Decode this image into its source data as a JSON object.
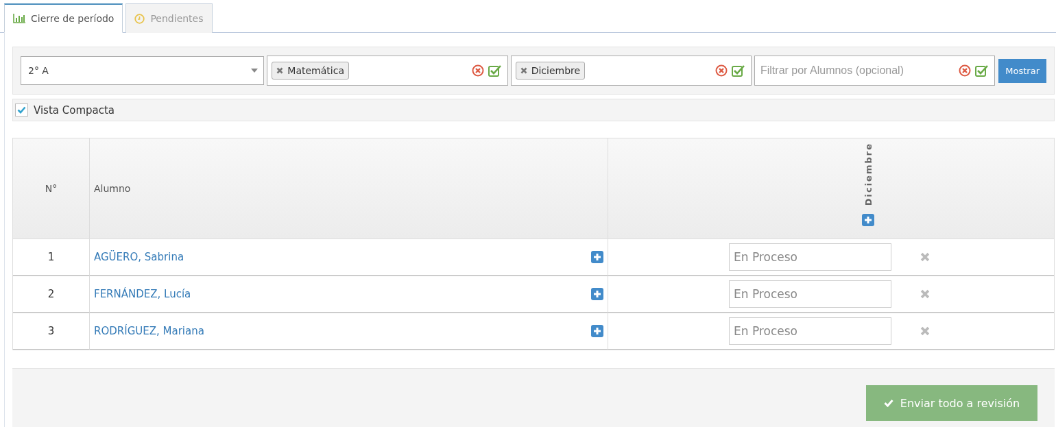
{
  "tabs": [
    {
      "label": "Cierre de período",
      "selected": true
    },
    {
      "label": "Pendientes",
      "selected": false
    }
  ],
  "filters": {
    "course_select": {
      "value": "2° A"
    },
    "tag_fields": [
      {
        "tags": [
          "Matemática"
        ]
      },
      {
        "tags": [
          "Diciembre"
        ]
      },
      {
        "placeholder": "Filtrar por Alumnos (opcional)"
      }
    ],
    "show_button": "Mostrar"
  },
  "compact_view": {
    "label": "Vista Compacta",
    "checked": true
  },
  "table": {
    "columns": [
      "N°",
      "Alumno",
      "Diciembre"
    ],
    "rows": [
      {
        "number": "1",
        "student": "AGÜERO, Sabrina",
        "placeholder": "En Proceso"
      },
      {
        "number": "2",
        "student": "FERNÁNDEZ, Lucía",
        "placeholder": "En Proceso"
      },
      {
        "number": "3",
        "student": "RODRÍGUEZ, Mariana",
        "placeholder": "En Proceso"
      }
    ]
  },
  "submit_button": "Enviar todo a revisión"
}
